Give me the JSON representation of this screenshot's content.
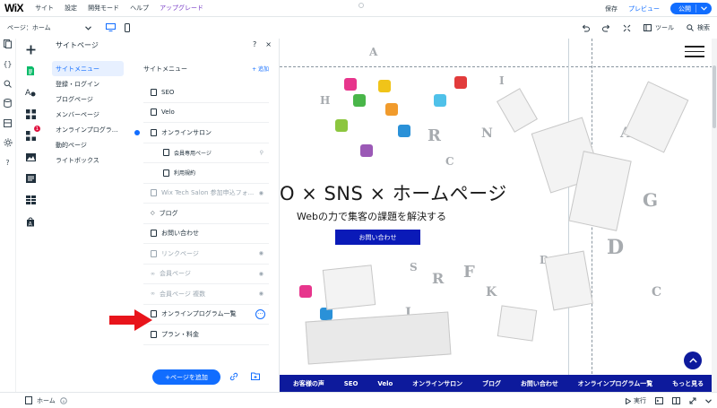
{
  "topbar": {
    "logo": "WiX",
    "menu": [
      "サイト",
      "設定",
      "開発モード",
      "ヘルプ",
      "アップグレード"
    ],
    "save": "保存",
    "preview": "プレビュー",
    "publish": "公開"
  },
  "bar2": {
    "page_select": "ページ：ホーム",
    "tools": "ツール",
    "search": "検索"
  },
  "panel": {
    "title": "サイトページ",
    "help": "?",
    "close": "×",
    "categories": [
      "サイトメニュー",
      "登録・ログイン",
      "ブログページ",
      "メンバーページ",
      "オンラインプログラ...",
      "動的ページ",
      "ライトボックス"
    ],
    "list_header": "サイトメニュー",
    "list_add": "+ 追加",
    "pages": [
      {
        "label": "SEO"
      },
      {
        "label": "Velo"
      },
      {
        "label": "オンラインサロン"
      },
      {
        "label": "会員専用ページ"
      },
      {
        "label": "利用規約"
      },
      {
        "label": "Wix Tech Salon 参加申込フォ..."
      },
      {
        "label": "ブログ"
      },
      {
        "label": "お問い合わせ"
      },
      {
        "label": "リンクページ"
      },
      {
        "label": "会員ページ"
      },
      {
        "label": "会員ページ 複数"
      },
      {
        "label": "オンラインプログラム一覧"
      },
      {
        "label": "プラン・料金"
      }
    ],
    "add_page": "+ページを追加"
  },
  "canvas": {
    "headline": "O × SNS × ホームページ",
    "subline": "Webの力で集客の課題を解決する",
    "cta": "お問い合わせ",
    "nav": [
      "お客様の声",
      "SEO",
      "Velo",
      "オンラインサロン",
      "ブログ",
      "お問い合わせ",
      "オンラインプログラム一覧",
      "もっと見る"
    ],
    "letters": [
      "A",
      "R",
      "R",
      "J",
      "F",
      "K",
      "G",
      "B",
      "C",
      "A",
      "N",
      "D",
      "H",
      "D",
      "F",
      "I",
      "C",
      "S"
    ]
  },
  "bottom": {
    "home": "ホーム",
    "run": "実行"
  },
  "colors": {
    "accent": "#116dff",
    "nav_blue": "#0d1a9c",
    "cta_blue": "#0a1ab8",
    "arrow_red": "#e8141b"
  }
}
